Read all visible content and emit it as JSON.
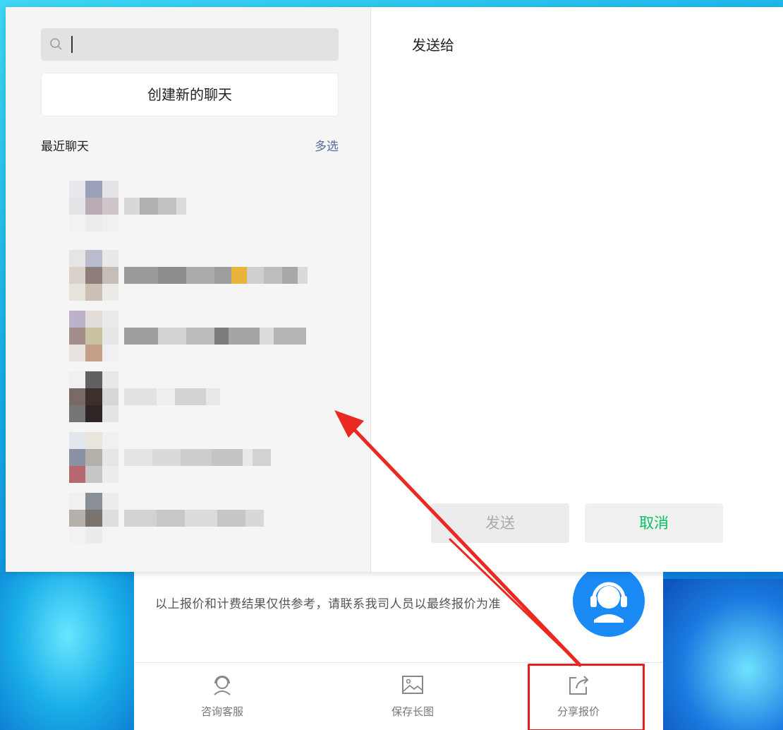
{
  "share_dialog": {
    "search": {
      "placeholder": "",
      "value": ""
    },
    "new_chat_label": "创建新的聊天",
    "recent_title": "最近聊天",
    "multi_select_label": "多选",
    "title": "发送给",
    "send_label": "发送",
    "cancel_label": "取消"
  },
  "app": {
    "disclaimer": "以上报价和计费结果仅供参考，请联系我司人员以最终报价为准",
    "tabs": [
      {
        "label": "咨询客服",
        "icon": "headset-icon"
      },
      {
        "label": "保存长图",
        "icon": "image-icon"
      },
      {
        "label": "分享报价",
        "icon": "share-icon"
      }
    ]
  },
  "colors": {
    "accent_green": "#07c160",
    "link_blue": "#576b95",
    "highlight_red": "#e02020",
    "fab_blue": "#1a8af5"
  }
}
